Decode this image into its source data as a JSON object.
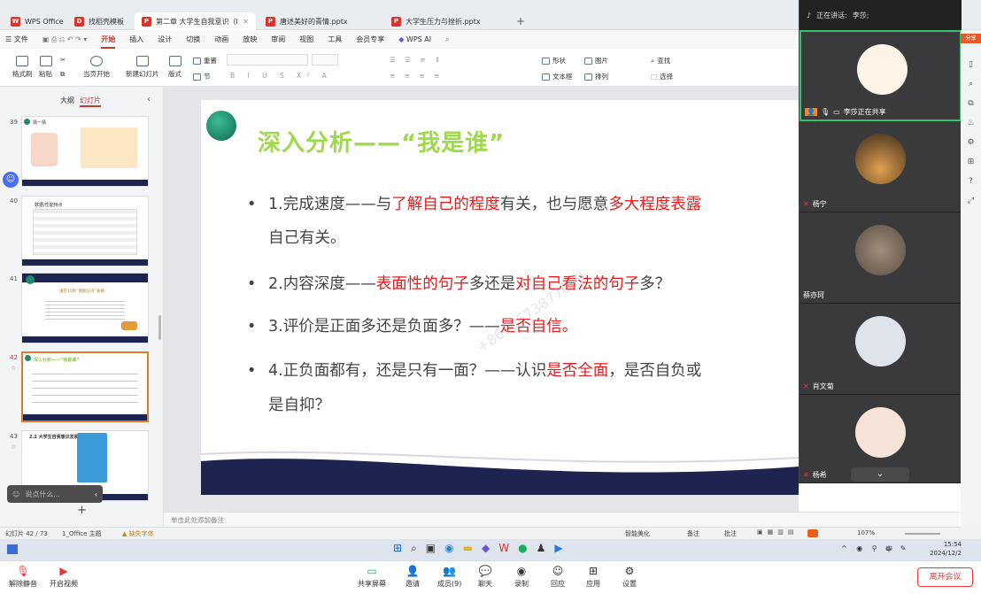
{
  "tabs": [
    {
      "label": "WPS Office",
      "color": "#d9342b",
      "glyph": "W"
    },
    {
      "label": "找稻壳模板",
      "color": "#d9342b",
      "glyph": "D"
    },
    {
      "label": "第二章 大学生自我意识（lisa）",
      "color": "#d9342b",
      "glyph": "P"
    },
    {
      "label": "唐述美好的青情.pptx",
      "color": "#d9342b",
      "glyph": "P"
    },
    {
      "label": "大学生压力与挫折.pptx",
      "color": "#d9342b",
      "glyph": "P"
    }
  ],
  "menu": [
    "文件",
    "开始",
    "插入",
    "设计",
    "切换",
    "动画",
    "放映",
    "审阅",
    "视图",
    "工具",
    "会员专享",
    "WPS AI"
  ],
  "active_menu": "开始",
  "ribbon": {
    "big": [
      "格式刷",
      "粘贴",
      "当页开始",
      "新建幻灯片",
      "版式",
      "节"
    ],
    "small": [
      "重置",
      "形状",
      "图片",
      "查找",
      "文本框",
      "排列",
      "选择"
    ]
  },
  "panel": {
    "tab_outline": "大纲",
    "tab_slides": "幻灯片"
  },
  "thumbs": [
    {
      "num": "39",
      "title": "猜一猜"
    },
    {
      "num": "40",
      "title": "数据/性能特点"
    },
    {
      "num": "41",
      "title": "请在15秒“我能认识”表格"
    },
    {
      "num": "42",
      "title": "深入分析——“我是谁”"
    },
    {
      "num": "43",
      "title": "2.2 大学生自我意识发展"
    }
  ],
  "chat_placeholder": "说点什么...",
  "slide": {
    "title": "深入分析——“我是谁”",
    "b1a": "1.完成速度——与",
    "b1r1": "了解自己的程度",
    "b1b": "有关，也与愿意",
    "b1r2": "多大程度表露",
    "b1c": "自己有关。",
    "b2a": "2.内容深度——",
    "b2r1": "表面性的句子",
    "b2b": "多还是",
    "b2r2": "对自己看法的句子",
    "b2c": "多？",
    "b3a": "3.评价是正面多还是负面多？——",
    "b3r": "是否自信。",
    "b4a": "4.正负面都有，还是只有一面？——认识",
    "b4r": "是否全面",
    "b4b": "，是否自负或",
    "b4c": "是自抑？",
    "bullet": "•"
  },
  "watermark": "+8613673877099",
  "notes_placeholder": "单击此处添加备注",
  "status": {
    "slide_count": "幻灯片 42 / 73",
    "theme": "1_Office 主题",
    "missing_font": "缺失字体",
    "smart": "智能美化",
    "notes": "备注",
    "comments": "批注",
    "zoom": "107%"
  },
  "meeting": {
    "speaking_label": "正在讲话:",
    "speaker": "李莎;",
    "share_label": "李莎正在共享",
    "participants": [
      {
        "name": "李莎",
        "bg": "#fdf3e6"
      },
      {
        "name": "杨宁",
        "bg": "#b07a3a"
      },
      {
        "name": "蔡亦珂",
        "bg": "#8a7a6e"
      },
      {
        "name": "肖文菊",
        "bg": "#d8dce6"
      },
      {
        "name": "杨希",
        "bg": "#f6e4d8"
      }
    ],
    "share_side": "分享"
  },
  "taskbar": {
    "time": "15:54",
    "date": "2024/12/2",
    "ime": "中"
  },
  "meetbar": {
    "mute": "解除静音",
    "video": "开启视频",
    "share": "共享屏幕",
    "invite": "邀请",
    "members": "成员(9)",
    "chat": "聊天",
    "record": "录制",
    "reply": "回应",
    "apps": "应用",
    "settings": "设置",
    "end": "离开会议"
  }
}
